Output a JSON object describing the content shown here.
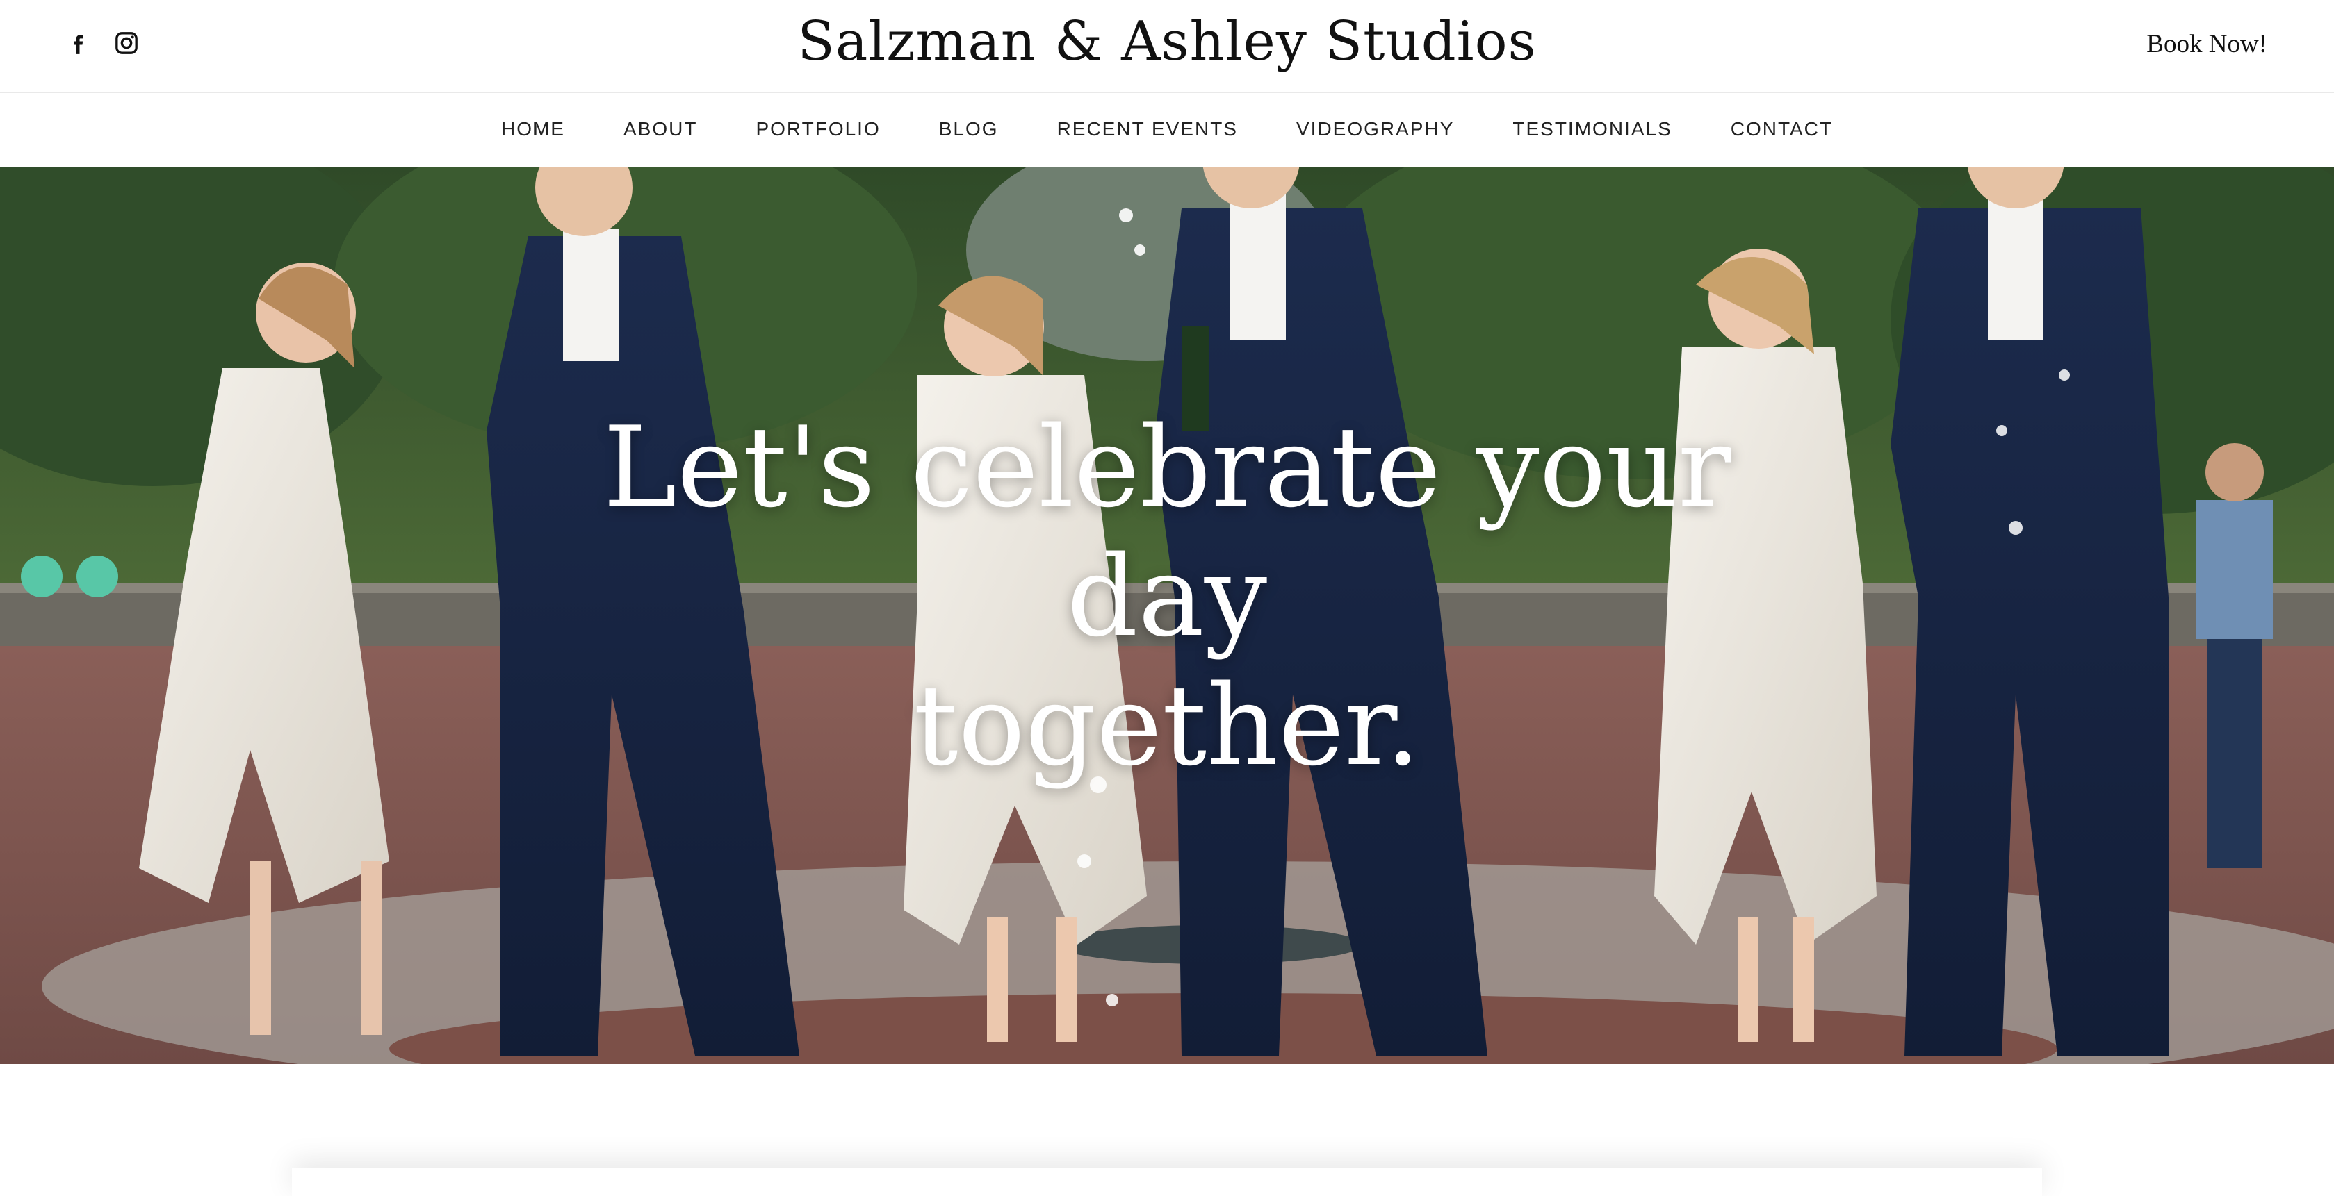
{
  "header": {
    "brand": "Salzman & Ashley Studios",
    "cta_label": "Book Now!",
    "social": [
      "facebook-icon",
      "instagram-icon"
    ]
  },
  "nav": {
    "items": [
      {
        "label": "HOME"
      },
      {
        "label": "ABOUT"
      },
      {
        "label": "PORTFOLIO"
      },
      {
        "label": "BLOG"
      },
      {
        "label": "RECENT EVENTS"
      },
      {
        "label": "VIDEOGRAPHY"
      },
      {
        "label": "TESTIMONIALS"
      },
      {
        "label": "CONTACT"
      }
    ]
  },
  "hero": {
    "headline_line1": "Let's celebrate your day",
    "headline_line2": "together."
  }
}
